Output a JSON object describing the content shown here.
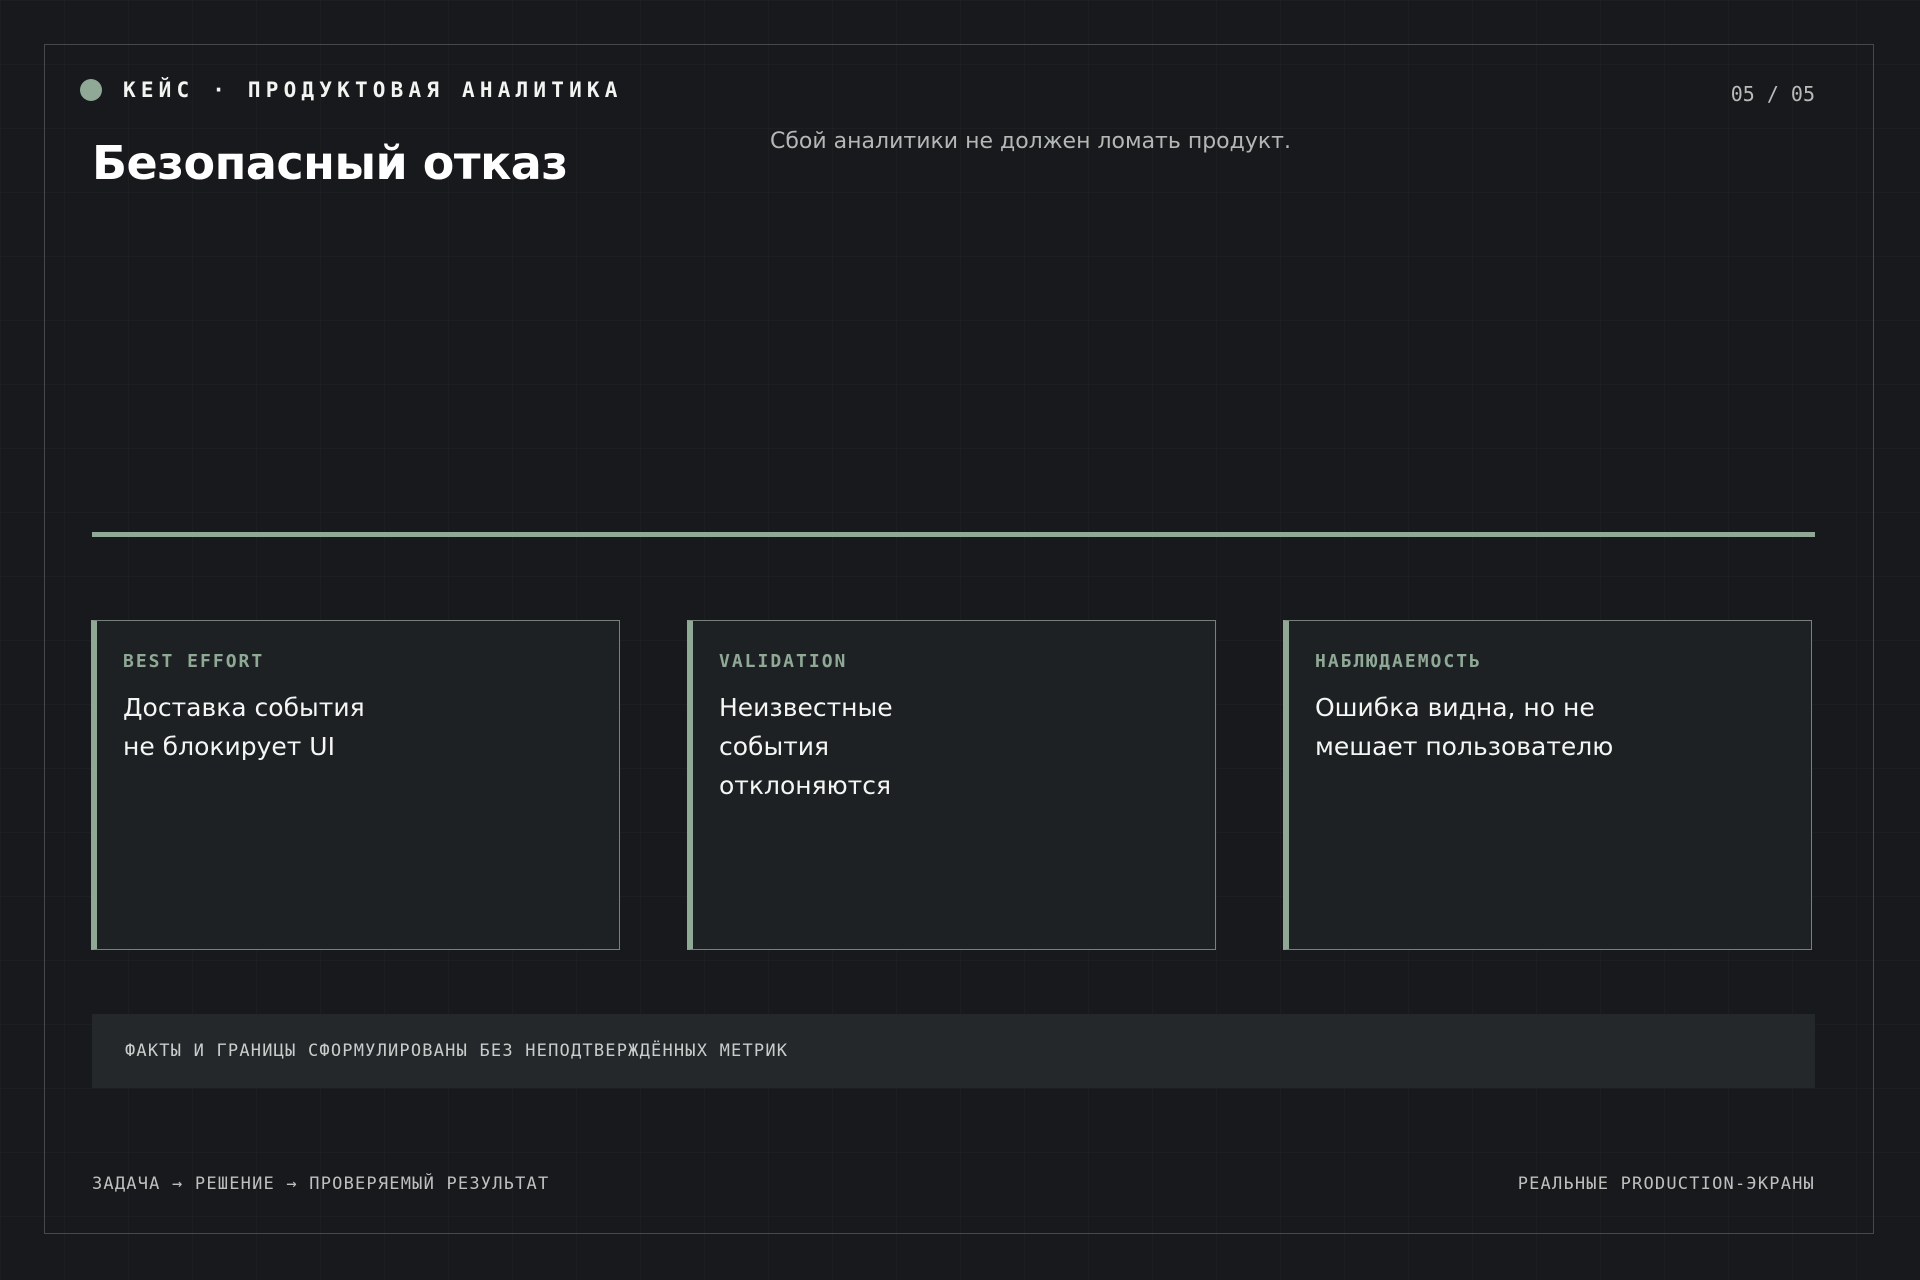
{
  "header": {
    "eyebrow": "КЕЙС · ПРОДУКТОВАЯ АНАЛИТИКА",
    "page_number": "05 / 05",
    "title": "Безопасный отказ",
    "subtitle": "Сбой аналитики не должен ломать продукт."
  },
  "cards": [
    {
      "tag": "BEST EFFORT",
      "text": "Доставка события не блокирует UI"
    },
    {
      "tag": "VALIDATION",
      "text": "Неизвестные события отклоняются"
    },
    {
      "tag": "НАБЛЮДАЕМОСТЬ",
      "text": "Ошибка видна, но не мешает пользователю"
    }
  ],
  "note": "ФАКТЫ И ГРАНИЦЫ СФОРМУЛИРОВАНЫ БЕЗ НЕПОДТВЕРЖДЁННЫХ МЕТРИК",
  "footer": {
    "left": "ЗАДАЧА → РЕШЕНИЕ → ПРОВЕРЯЕМЫЙ РЕЗУЛЬТАТ",
    "right": "РЕАЛЬНЫЕ PRODUCTION-ЭКРАНЫ"
  },
  "colors": {
    "background": "#18191c",
    "accent": "#8fa996",
    "card_background": "#1e2124",
    "note_background": "#25282b"
  }
}
